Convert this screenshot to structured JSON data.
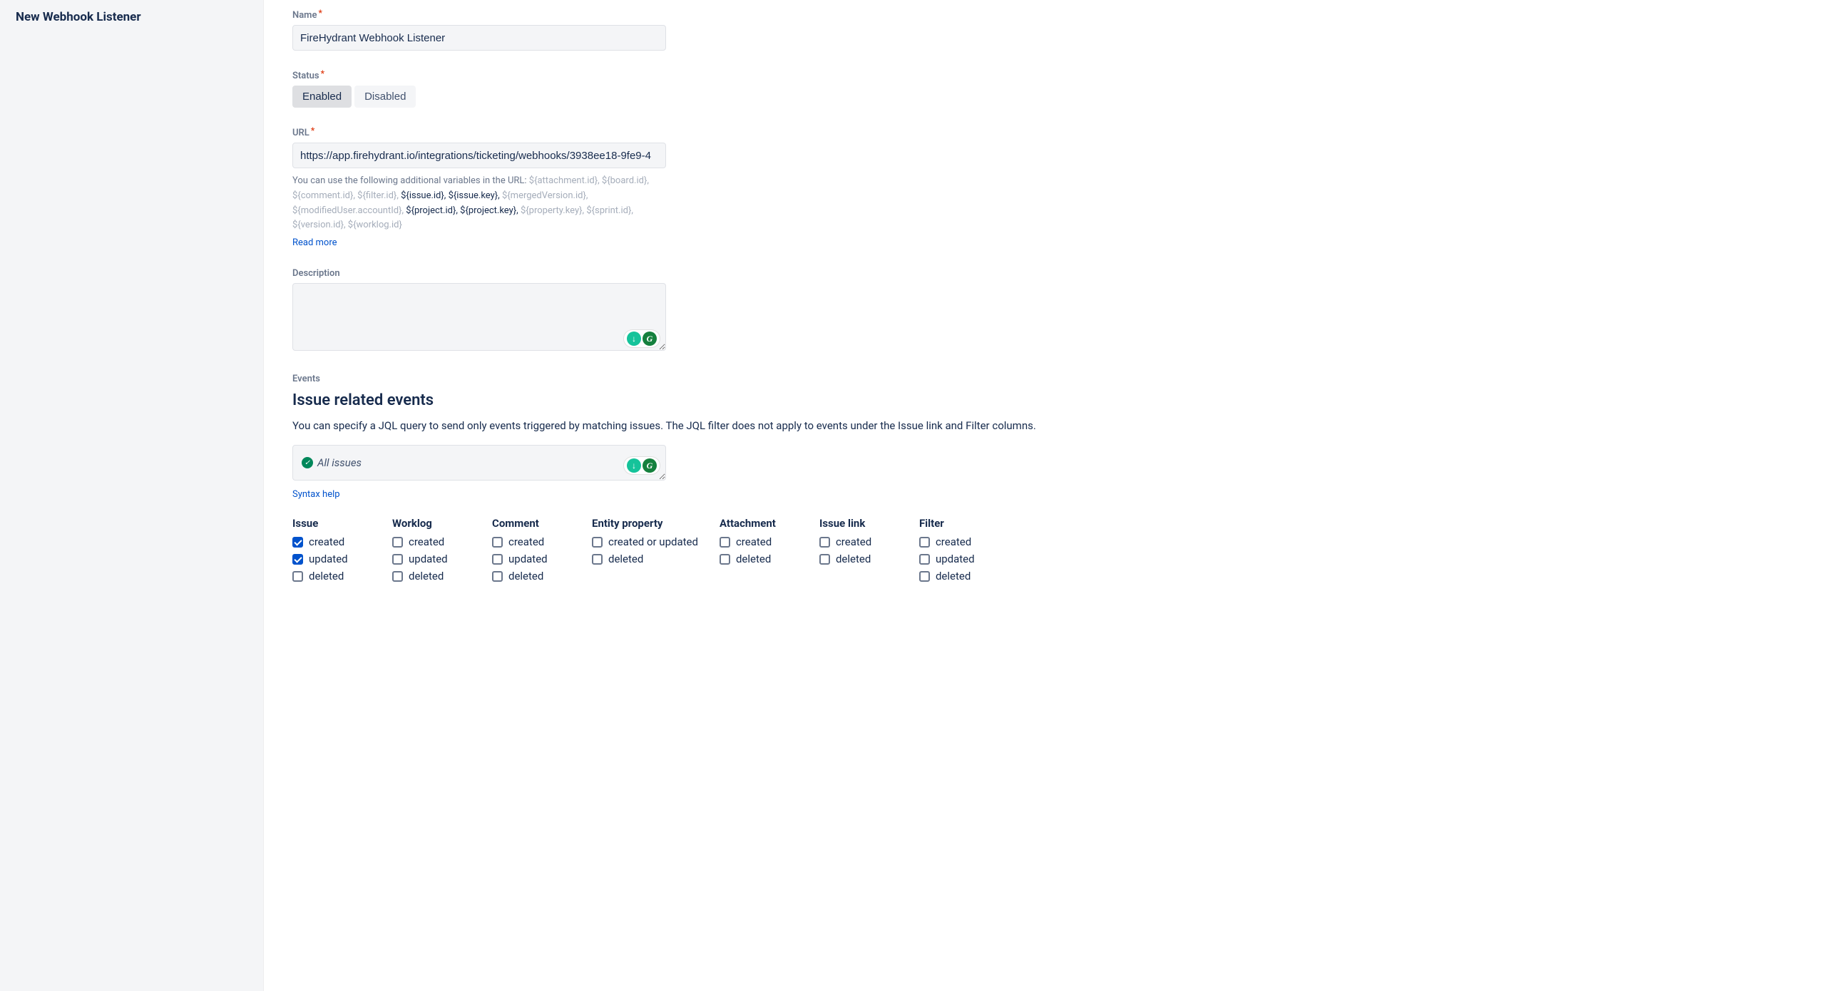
{
  "sidebar": {
    "title": "New Webhook Listener"
  },
  "form": {
    "name_label": "Name",
    "name_value": "FireHydrant Webhook Listener",
    "status_label": "Status",
    "status_enabled": "Enabled",
    "status_disabled": "Disabled",
    "url_label": "URL",
    "url_value": "https://app.firehydrant.io/integrations/ticketing/webhooks/3938ee18-9fe9-4",
    "url_help_prefix": "You can use the following additional variables in the URL: ",
    "url_vars": [
      {
        "text": "${attachment.id},",
        "dark": false
      },
      {
        "text": " ${board.id},",
        "dark": false
      },
      {
        "text": " ${comment.id},",
        "dark": false
      },
      {
        "text": " ${filter.id},",
        "dark": false
      },
      {
        "text": " ${issue.id},",
        "dark": true
      },
      {
        "text": " ${issue.key},",
        "dark": true
      },
      {
        "text": " ${mergedVersion.id},",
        "dark": false
      },
      {
        "text": " ${modifiedUser.accountId},",
        "dark": false
      },
      {
        "text": " ${project.id},",
        "dark": true
      },
      {
        "text": " ${project.key},",
        "dark": true
      },
      {
        "text": " ${property.key},",
        "dark": false
      },
      {
        "text": " ${sprint.id},",
        "dark": false
      },
      {
        "text": " ${version.id},",
        "dark": false
      },
      {
        "text": " ${worklog.id}",
        "dark": false
      }
    ],
    "read_more": "Read more",
    "description_label": "Description",
    "description_value": ""
  },
  "events": {
    "small_label": "Events",
    "heading": "Issue related events",
    "description": "You can specify a JQL query to send only events triggered by matching issues. The JQL filter does not apply to events under the Issue link and Filter columns.",
    "jql_placeholder": "All issues",
    "syntax_help": "Syntax help",
    "columns": [
      {
        "title": "Issue",
        "items": [
          {
            "label": "created",
            "checked": true
          },
          {
            "label": "updated",
            "checked": true
          },
          {
            "label": "deleted",
            "checked": false
          }
        ]
      },
      {
        "title": "Worklog",
        "items": [
          {
            "label": "created",
            "checked": false
          },
          {
            "label": "updated",
            "checked": false
          },
          {
            "label": "deleted",
            "checked": false
          }
        ]
      },
      {
        "title": "Comment",
        "items": [
          {
            "label": "created",
            "checked": false
          },
          {
            "label": "updated",
            "checked": false
          },
          {
            "label": "deleted",
            "checked": false
          }
        ]
      },
      {
        "title": "Entity property",
        "items": [
          {
            "label": "created or updated",
            "checked": false
          },
          {
            "label": "deleted",
            "checked": false
          }
        ]
      },
      {
        "title": "Attachment",
        "items": [
          {
            "label": "created",
            "checked": false
          },
          {
            "label": "deleted",
            "checked": false
          }
        ]
      },
      {
        "title": "Issue link",
        "items": [
          {
            "label": "created",
            "checked": false
          },
          {
            "label": "deleted",
            "checked": false
          }
        ]
      },
      {
        "title": "Filter",
        "items": [
          {
            "label": "created",
            "checked": false
          },
          {
            "label": "updated",
            "checked": false
          },
          {
            "label": "deleted",
            "checked": false
          }
        ]
      }
    ]
  }
}
